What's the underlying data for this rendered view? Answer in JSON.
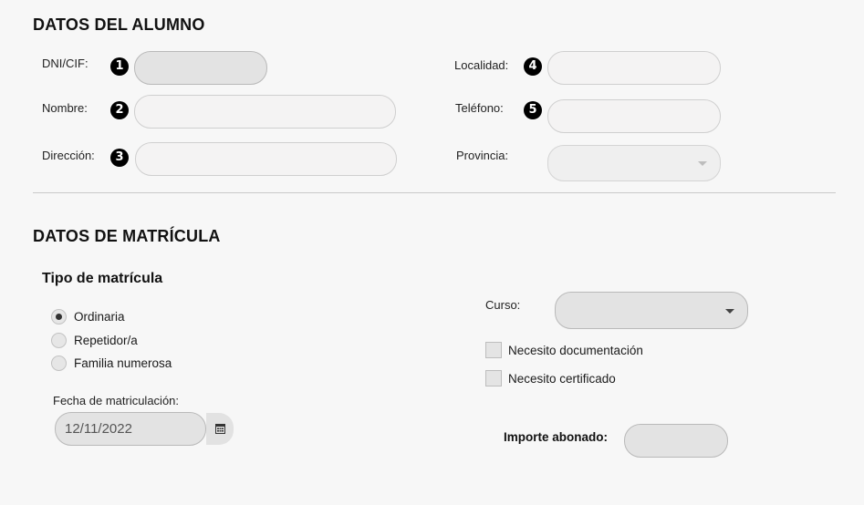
{
  "student_section": {
    "title": "DATOS DEL ALUMNO",
    "dni_label": "DNI/CIF:",
    "dni_badge": "1",
    "dni_value": "",
    "nombre_label": "Nombre:",
    "nombre_badge": "2",
    "nombre_value": "",
    "direccion_label": "Dirección:",
    "direccion_badge": "3",
    "direccion_value": "",
    "localidad_label": "Localidad:",
    "localidad_badge": "4",
    "localidad_value": "",
    "telefono_label": "Teléfono:",
    "telefono_badge": "5",
    "telefono_value": "",
    "provincia_label": "Provincia:",
    "provincia_value": ""
  },
  "enrollment_section": {
    "title": "DATOS DE MATRÍCULA",
    "tipo_title": "Tipo de matrícula",
    "options": [
      {
        "label": "Ordinaria",
        "selected": true
      },
      {
        "label": "Repetidor/a",
        "selected": false
      },
      {
        "label": "Familia numerosa",
        "selected": false
      }
    ],
    "fecha_label": "Fecha de matriculación:",
    "fecha_value": "12/11/2022",
    "calendar_icon": "calendar-icon",
    "curso_label": "Curso:",
    "curso_value": "",
    "doc_label": "Necesito documentación",
    "doc_checked": false,
    "cert_label": "Necesito certificado",
    "cert_checked": false,
    "importe_label": "Importe abonado:",
    "importe_value": ""
  }
}
